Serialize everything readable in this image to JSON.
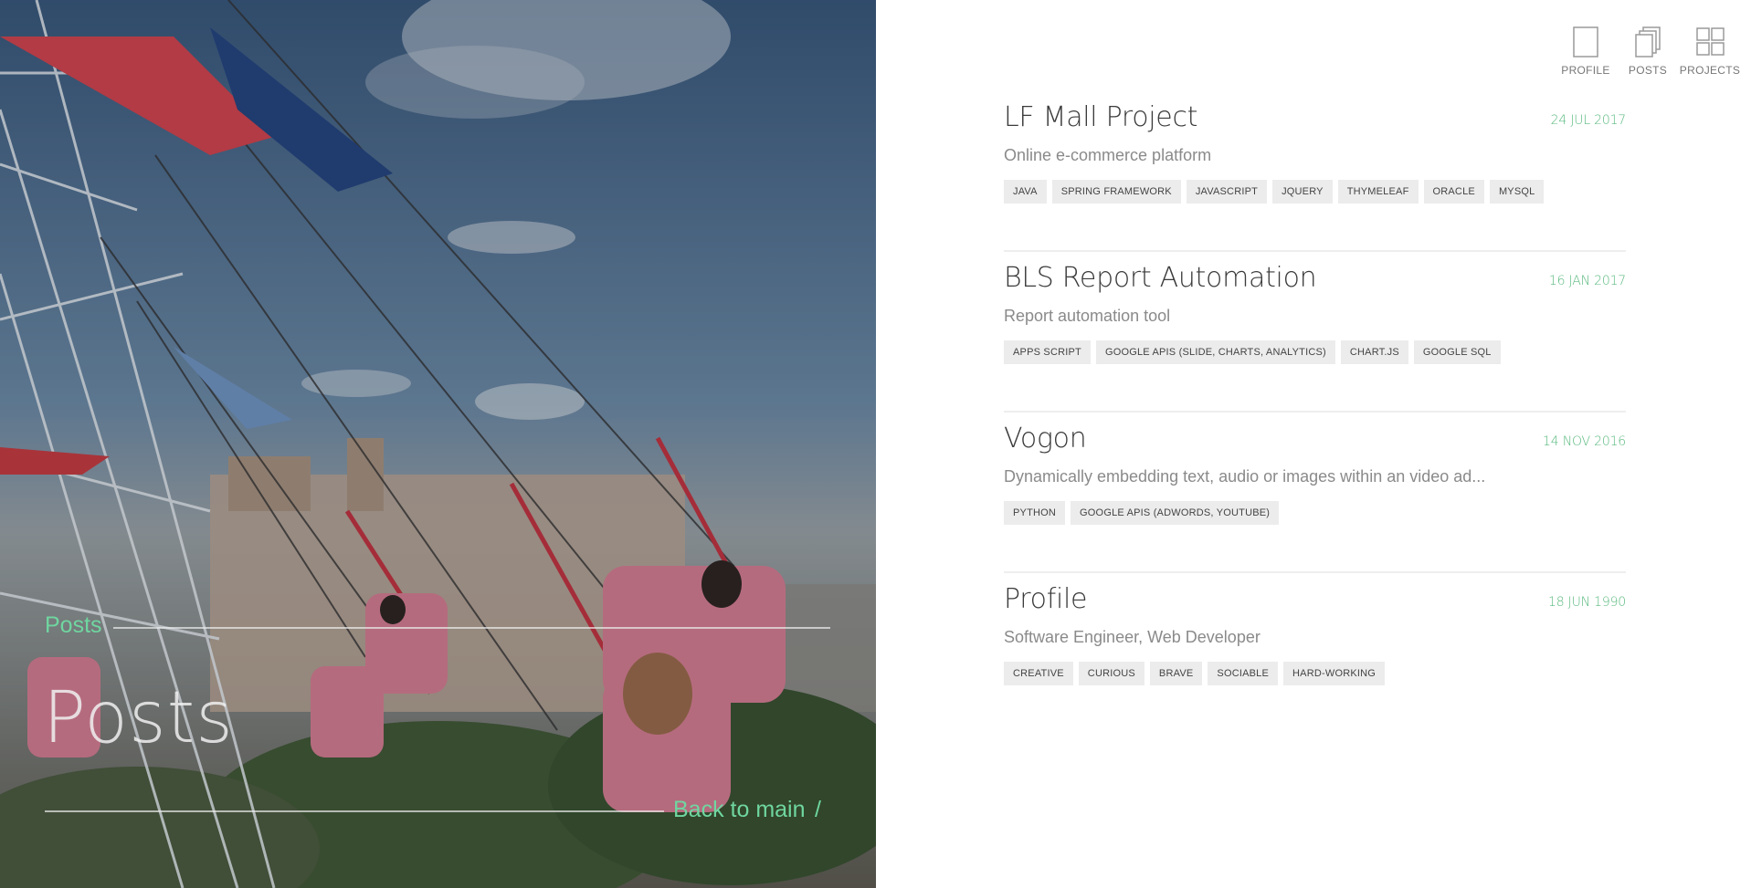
{
  "hero": {
    "crumb": "Posts",
    "title": "Posts",
    "back_link": "Back to main",
    "back_separator": "/"
  },
  "nav": {
    "items": [
      {
        "label": "PROFILE",
        "icon": "profile-page-icon"
      },
      {
        "label": "POSTS",
        "icon": "posts-stack-icon"
      },
      {
        "label": "PROJECTS",
        "icon": "projects-grid-icon"
      }
    ]
  },
  "posts": [
    {
      "title": "LF Mall Project",
      "date": "24 JUL 2017",
      "subtitle": "Online e-commerce platform",
      "tags": [
        "JAVA",
        "SPRING FRAMEWORK",
        "JAVASCRIPT",
        "JQUERY",
        "THYMELEAF",
        "ORACLE",
        "MYSQL"
      ]
    },
    {
      "title": "BLS Report Automation",
      "date": "16 JAN 2017",
      "subtitle": "Report automation tool",
      "tags": [
        "APPS SCRIPT",
        "GOOGLE APIS (SLIDE, CHARTS, ANALYTICS)",
        "CHART.JS",
        "GOOGLE SQL"
      ]
    },
    {
      "title": "Vogon",
      "date": "14 NOV 2016",
      "subtitle": "Dynamically embedding text, audio or images within an video ad...",
      "tags": [
        "PYTHON",
        "GOOGLE APIS (ADWORDS, YOUTUBE)"
      ]
    },
    {
      "title": "Profile",
      "date": "18 JUN 1990",
      "subtitle": "Software Engineer, Web Developer",
      "tags": [
        "CREATIVE",
        "CURIOUS",
        "BRAVE",
        "SOCIABLE",
        "HARD-WORKING"
      ]
    }
  ],
  "colors": {
    "accent": "#6fd6a0",
    "date": "#59b97e",
    "tag_bg": "#ececec"
  }
}
